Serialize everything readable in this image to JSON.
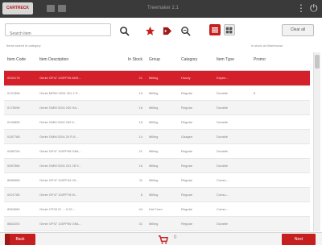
{
  "app": {
    "brand": "CARTRECK",
    "window_title": "Treemaker 2.1",
    "top_right_icons": [
      "more-vertical-icon",
      "power-icon"
    ]
  },
  "toolbar": {
    "search_placeholder": "Search item",
    "icons": [
      "search-icon",
      "favorite-star-icon",
      "tag-icon",
      "zoom-filter-icon"
    ],
    "view_modes": [
      "list-view",
      "grid-view"
    ],
    "active_view": "list-view",
    "clear_all_label": "Clear all"
  },
  "labels": {
    "left_status": "Items stored in category",
    "right_status": "in stock at Warehouse"
  },
  "table": {
    "headers": [
      "Item Code",
      "Item Description",
      "In Stock",
      "Group",
      "Category",
      "Item Type",
      "Promo"
    ],
    "rows": [
      [
        "0000178",
        "Genie GP47 100FP25 ANS...",
        "21",
        "Milling",
        "Hourly",
        "Expen...",
        ""
      ],
      [
        "0147856",
        "Genie MR00 0204 201 2 P...",
        "16",
        "Milling",
        "Regular",
        "Durable",
        "8"
      ],
      [
        "0178096",
        "Genie GMM 0204 200 HA...",
        "16",
        "Milling",
        "Regular",
        "Durable",
        ""
      ],
      [
        "0145856",
        "Genie GMM 0204 200 K...",
        "16",
        "Milling",
        "Regular",
        "Durable",
        ""
      ],
      [
        "0187788",
        "Genie GMM 0204 20 R 8...",
        "14",
        "Milling",
        "Gaaged",
        "Durable",
        ""
      ],
      [
        "0085706",
        "Genie GP47 100FP98 GML...",
        "21",
        "Milling",
        "Regular",
        "Durable",
        ""
      ],
      [
        "0087586",
        "Genie GMM 0204 201 28 S...",
        "16",
        "Milling",
        "Regular",
        "Durable",
        ""
      ],
      [
        "8686568",
        "Genie GP47 100FP44 29...",
        "11",
        "Milling",
        "Regular",
        "Consu...",
        ""
      ],
      [
        "0021786",
        "Genie GP47 100FP78 M...",
        "8",
        "Milling",
        "Regular",
        "Consu...",
        ""
      ],
      [
        "8962680",
        "Genie CP28 21 ... 0.29 ...",
        "44",
        "Hot Form",
        "Regular",
        "Consu...",
        ""
      ],
      [
        "8864200",
        "Genie GP47 100FP55 GML...",
        "31",
        "Milling",
        "Regular",
        "Durable",
        ""
      ]
    ],
    "selected_row": 0
  },
  "footer": {
    "back_label": "Back",
    "next_label": "Next",
    "cart_count": "0"
  },
  "colors": {
    "accent": "#c61f1f",
    "topbar": "#3a3a3a",
    "selected_row": "#d3202a"
  }
}
